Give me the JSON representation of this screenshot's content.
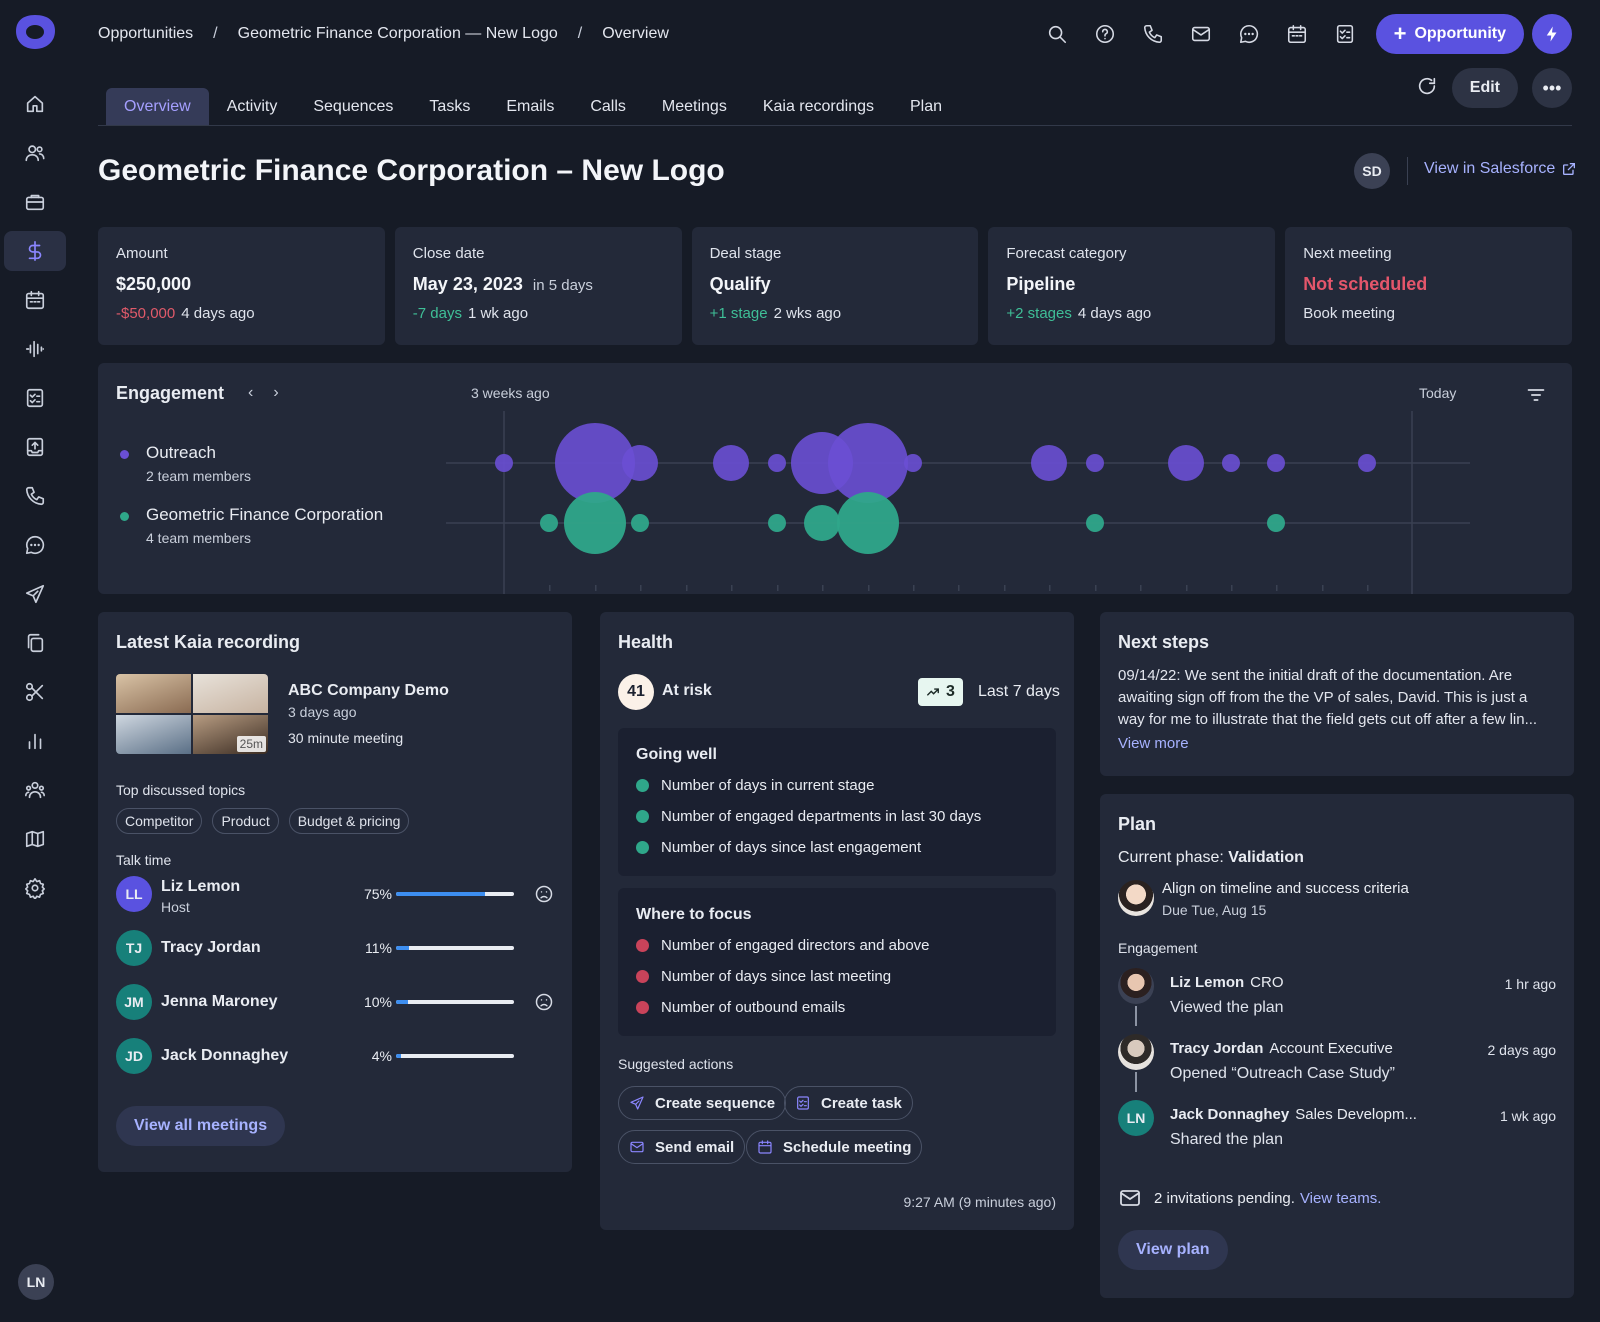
{
  "colors": {
    "accent": "#5a52e0",
    "outreach": "#6a4fd4",
    "customer": "#2fa78a",
    "negative": "#e05a6a",
    "positive": "#3fbf97"
  },
  "breadcrumb": [
    "Opportunities",
    "Geometric Finance Corporation — New Logo",
    "Overview"
  ],
  "breadcrumb_sep": "/",
  "header": {
    "new_button": "Opportunity"
  },
  "tabs": [
    "Overview",
    "Activity",
    "Sequences",
    "Tasks",
    "Emails",
    "Calls",
    "Meetings",
    "Kaia recordings",
    "Plan"
  ],
  "actions": {
    "edit": "Edit"
  },
  "title": "Geometric Finance Corporation – New Logo",
  "owner_initials": "SD",
  "salesforce_link": "View in Salesforce",
  "metrics": {
    "amount": {
      "label": "Amount",
      "value": "$250,000",
      "delta": "-$50,000",
      "when": "4 days ago"
    },
    "close": {
      "label": "Close date",
      "value": "May 23, 2023",
      "note": "in 5 days",
      "delta": "-7 days",
      "when": "1 wk ago"
    },
    "stage": {
      "label": "Deal stage",
      "value": "Qualify",
      "delta": "+1 stage",
      "when": "2 wks ago"
    },
    "forecast": {
      "label": "Forecast category",
      "value": "Pipeline",
      "delta": "+2 stages",
      "when": "4 days ago"
    },
    "meeting": {
      "label": "Next meeting",
      "value": "Not scheduled",
      "action": "Book meeting"
    }
  },
  "engagement": {
    "title": "Engagement",
    "start_label": "3 weeks ago",
    "end_label": "Today",
    "legend": [
      {
        "name": "Outreach",
        "sub": "2 team members"
      },
      {
        "name": "Geometric Finance Corporation",
        "sub": "4 team members"
      }
    ]
  },
  "kaia": {
    "title": "Latest Kaia recording",
    "recording": {
      "name": "ABC Company Demo",
      "when": "3 days ago",
      "length": "30 minute meeting",
      "duration_badge": "25m"
    },
    "topics_label": "Top discussed topics",
    "topics": [
      "Competitor",
      "Product",
      "Budget & pricing"
    ],
    "talk_label": "Talk time",
    "speakers": [
      {
        "initials": "LL",
        "name": "Liz Lemon",
        "role": "Host",
        "pct": "75%",
        "fraction": 0.75,
        "sad": true,
        "color": "#5a52e0"
      },
      {
        "initials": "TJ",
        "name": "Tracy Jordan",
        "role": "",
        "pct": "11%",
        "fraction": 0.11,
        "sad": false,
        "color": "#17807a"
      },
      {
        "initials": "JM",
        "name": "Jenna Maroney",
        "role": "",
        "pct": "10%",
        "fraction": 0.1,
        "sad": true,
        "color": "#17807a"
      },
      {
        "initials": "JD",
        "name": "Jack Donnaghey",
        "role": "",
        "pct": "4%",
        "fraction": 0.04,
        "sad": false,
        "color": "#17807a"
      }
    ],
    "view_all": "View all meetings"
  },
  "health": {
    "title": "Health",
    "score": "41",
    "status": "At risk",
    "trend": "3",
    "trend_period": "Last 7 days",
    "going_well_title": "Going well",
    "going_well": [
      "Number of days in current stage",
      "Number of engaged departments in last 30 days",
      "Number of days since last engagement"
    ],
    "focus_title": "Where to focus",
    "focus": [
      "Number of engaged directors and above",
      "Number of days since last meeting",
      "Number of outbound emails"
    ],
    "suggested_label": "Suggested actions",
    "suggested": [
      "Create sequence",
      "Create task",
      "Send email",
      "Schedule meeting"
    ],
    "timestamp": "9:27 AM (9 minutes ago)"
  },
  "next_steps": {
    "title": "Next steps",
    "text": "09/14/22: We sent the initial draft of the documentation. Are awaiting sign off from the the VP of sales, David. This is just a way for me to illustrate that the field gets cut off after a few lin...",
    "more": "View more"
  },
  "plan": {
    "title": "Plan",
    "phase_label": "Current phase:",
    "phase": "Validation",
    "milestone": {
      "title": "Align on timeline and success criteria",
      "due": "Due Tue, Aug 15"
    },
    "engagement_label": "Engagement",
    "activity": [
      {
        "name": "Liz Lemon",
        "role": "CRO",
        "action": "Viewed the plan",
        "time": "1 hr ago"
      },
      {
        "name": "Tracy Jordan",
        "role": "Account Executive",
        "action": "Opened “Outreach Case Study”",
        "time": "2 days ago"
      },
      {
        "name": "Jack Donnaghey",
        "role": "Sales Developm...",
        "action": "Shared the plan",
        "time": "1 wk ago",
        "initials": "LN"
      }
    ],
    "invites_text": "2 invitations pending.",
    "invites_link": "View teams.",
    "view_plan": "View plan"
  },
  "user_initials": "LN"
}
